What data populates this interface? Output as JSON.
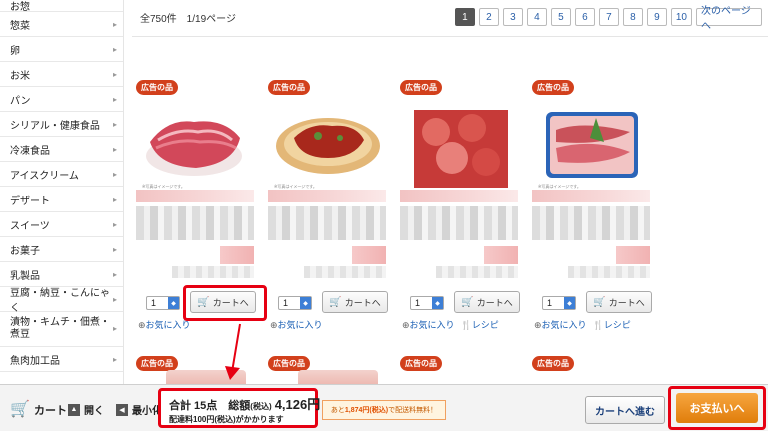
{
  "sidebar": {
    "items": [
      {
        "label": "お惣"
      },
      {
        "label": "惣菜"
      },
      {
        "label": "卵"
      },
      {
        "label": "お米"
      },
      {
        "label": "パン"
      },
      {
        "label": "シリアル・健康食品"
      },
      {
        "label": "冷凍食品"
      },
      {
        "label": "アイスクリーム"
      },
      {
        "label": "デザート"
      },
      {
        "label": "スイーツ"
      },
      {
        "label": "お菓子"
      },
      {
        "label": "乳製品"
      },
      {
        "label": "豆腐・納豆・こんにゃく"
      },
      {
        "label": "漬物・キムチ・佃煮・煮豆"
      },
      {
        "label": "魚肉加工品"
      }
    ],
    "arrow": "▸"
  },
  "results": {
    "count_text": "全750件　1/19ページ"
  },
  "pager": {
    "pages": [
      "1",
      "2",
      "3",
      "4",
      "5",
      "6",
      "7",
      "8",
      "9",
      "10"
    ],
    "next_label": "次のページへ"
  },
  "products": [
    {
      "badge": "広告の品",
      "image_caption": "※写真はイメージです。",
      "qty": "1",
      "cart_label": "カートへ",
      "fav_label": "お気に入り",
      "recipe_label": ""
    },
    {
      "badge": "広告の品",
      "image_caption": "※写真はイメージです。",
      "qty": "1",
      "cart_label": "カートへ",
      "fav_label": "お気に入り",
      "recipe_label": ""
    },
    {
      "badge": "広告の品",
      "image_caption": "",
      "qty": "1",
      "cart_label": "カートへ",
      "fav_label": "お気に入り",
      "recipe_label": "レシピ"
    },
    {
      "badge": "広告の品",
      "image_caption": "※写真はイメージです。",
      "qty": "1",
      "cart_label": "カートへ",
      "fav_label": "お気に入り",
      "recipe_label": "レシピ"
    }
  ],
  "products_row2": [
    {
      "badge": "広告の品"
    },
    {
      "badge": "広告の品"
    },
    {
      "badge": "広告の品"
    },
    {
      "badge": "広告の品"
    }
  ],
  "cartbar": {
    "cart_label": "カート",
    "open_label": "開く",
    "minimize_label": "最小化",
    "summary_line1_prefix": "合計 15点　総額",
    "summary_taxnote": "(税込)",
    "summary_amount": "4,126円",
    "summary_line2": "配達料100円(税込)がかかります",
    "free_shipping_prefix": "あと",
    "free_shipping_amount": "1,874円(税込)",
    "free_shipping_suffix": "で配送料無料！",
    "to_cart_label": "カートへ進む",
    "checkout_label": "お支払いへ"
  },
  "colors": {
    "highlight": "#e60012",
    "ad_badge": "#d2401c",
    "checkout": "#f09020",
    "link": "#1a5fb4"
  }
}
